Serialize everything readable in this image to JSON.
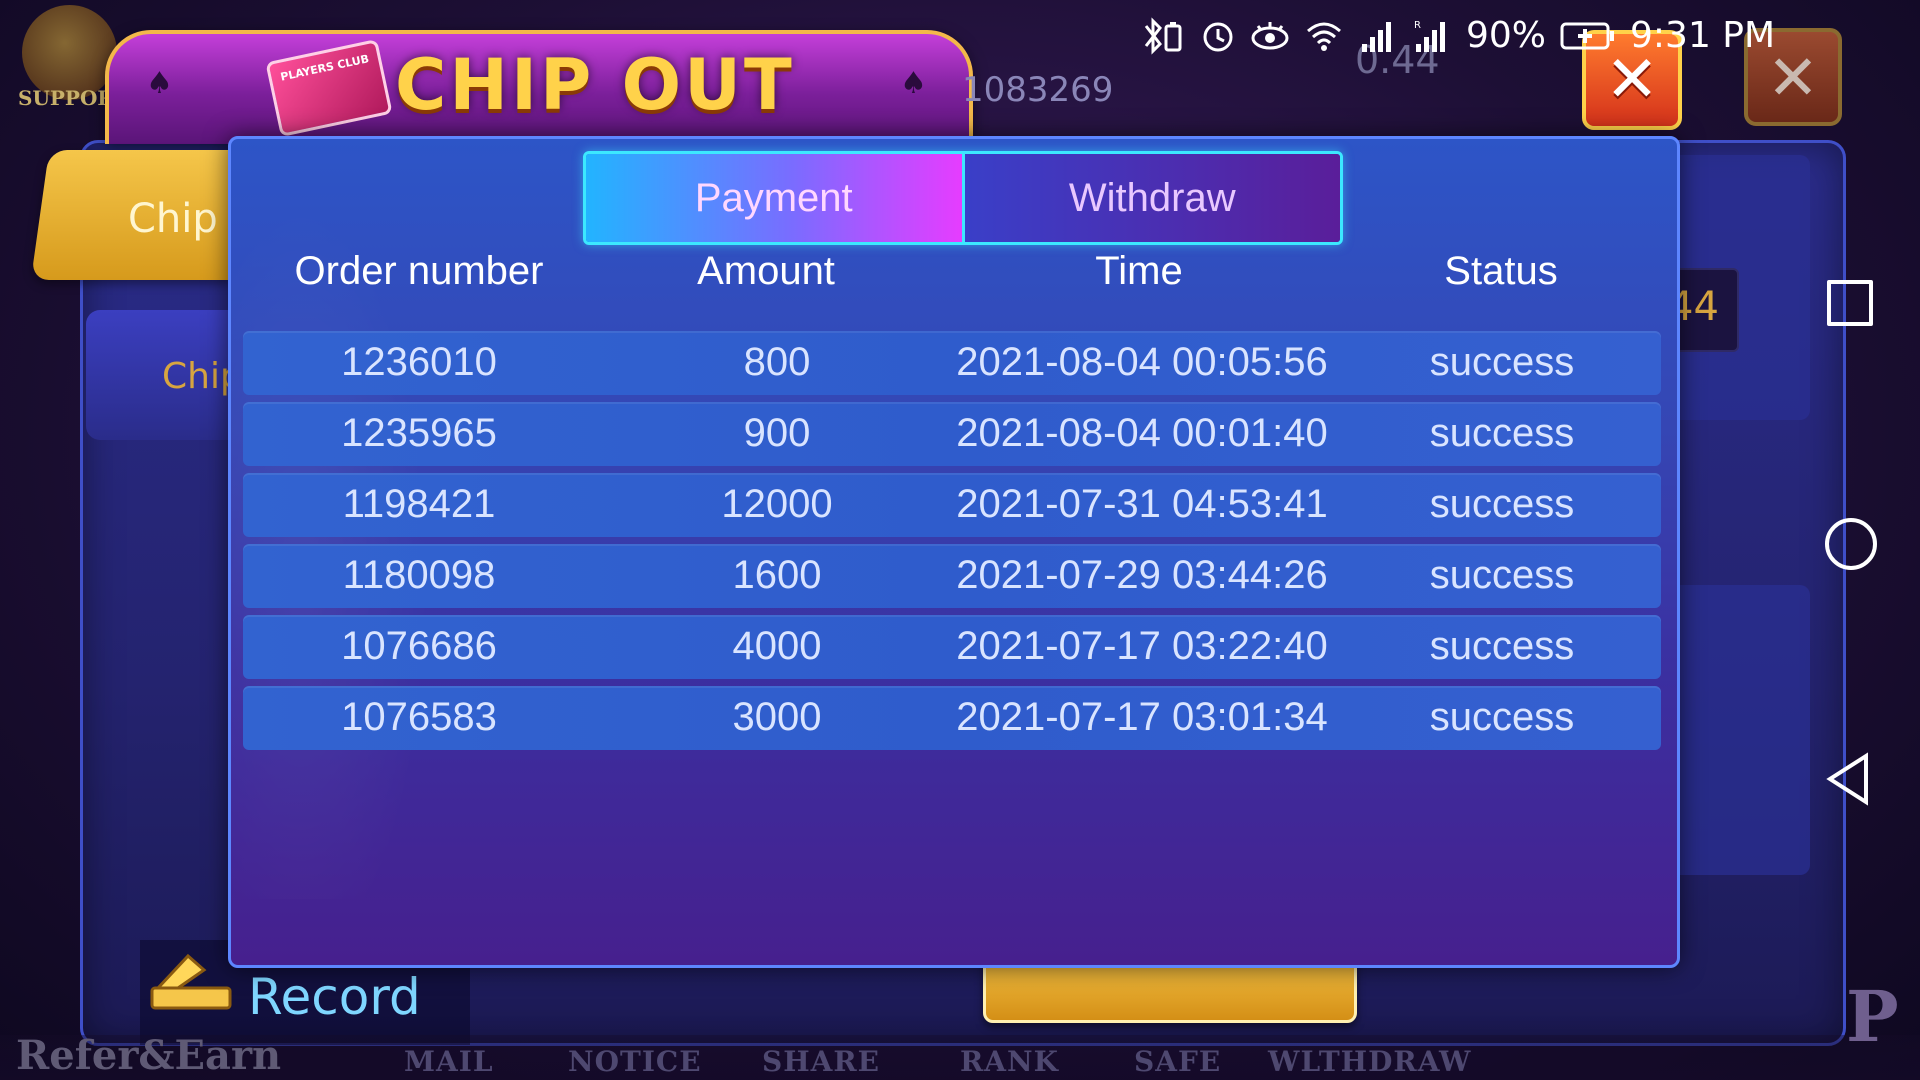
{
  "background": {
    "title": "CHIP OUT",
    "players_club": "PLAYERS CLUB",
    "support_label": "SUPPORT",
    "user_id": "1083269",
    "balance": "0.44",
    "side_tab_gold_label": "Chip t",
    "side_tab_blue_label": "Chip",
    "right_value": "44",
    "record_label": "Record",
    "refer_label": "Refer&Earn",
    "bottom_nav": [
      "MAIL",
      "NOTICE",
      "SHARE",
      "RANK",
      "SAFE",
      "WLTHDRAW"
    ],
    "p_letter": "P"
  },
  "status_bar": {
    "battery_percent": "90%",
    "time": "9:31 PM",
    "signal_label": "R"
  },
  "modal": {
    "tabs": [
      {
        "label": "Payment",
        "active": true
      },
      {
        "label": "Withdraw",
        "active": false
      }
    ],
    "columns": [
      "Order number",
      "Amount",
      "Time",
      "Status"
    ],
    "rows": [
      {
        "order": "1236010",
        "amount": "800",
        "time": "2021-08-04 00:05:56",
        "status": "success"
      },
      {
        "order": "1235965",
        "amount": "900",
        "time": "2021-08-04 00:01:40",
        "status": "success"
      },
      {
        "order": "1198421",
        "amount": "12000",
        "time": "2021-07-31 04:53:41",
        "status": "success"
      },
      {
        "order": "1180098",
        "amount": "1600",
        "time": "2021-07-29 03:44:26",
        "status": "success"
      },
      {
        "order": "1076686",
        "amount": "4000",
        "time": "2021-07-17 03:22:40",
        "status": "success"
      },
      {
        "order": "1076583",
        "amount": "3000",
        "time": "2021-07-17 03:01:34",
        "status": "success"
      }
    ]
  },
  "colors": {
    "accent_cyan": "#3ce8ff",
    "title_gold": "#ffd24a",
    "record_blue": "#7fd6ff"
  }
}
